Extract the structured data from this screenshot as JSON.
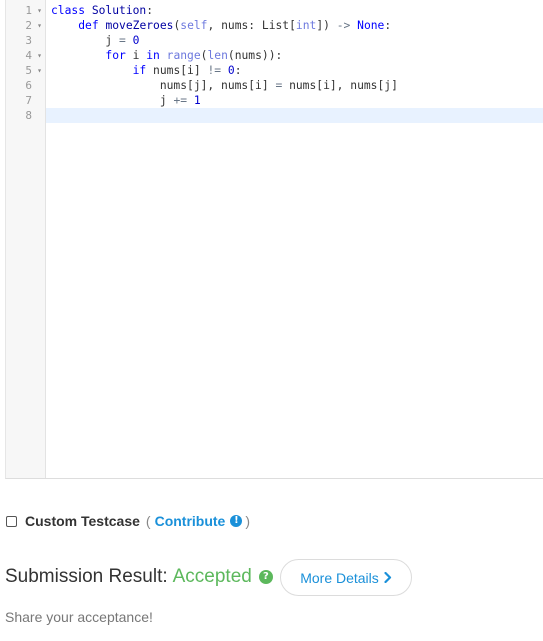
{
  "editor": {
    "line_numbers": [
      "1",
      "2",
      "3",
      "4",
      "5",
      "6",
      "7",
      "8"
    ],
    "fold_markers": [
      "▾",
      "▾",
      "",
      "▾",
      "▾",
      "",
      "",
      ""
    ],
    "active_line": 8,
    "lines": [
      [
        {
          "t": "class",
          "c": "kw"
        },
        {
          "t": " ",
          "c": "plain"
        },
        {
          "t": "Solution",
          "c": "cls"
        },
        {
          "t": ":",
          "c": "plain"
        }
      ],
      [
        {
          "t": "    ",
          "c": "plain"
        },
        {
          "t": "def",
          "c": "kw"
        },
        {
          "t": " ",
          "c": "plain"
        },
        {
          "t": "moveZeroes",
          "c": "fn"
        },
        {
          "t": "(",
          "c": "plain"
        },
        {
          "t": "self",
          "c": "builtin"
        },
        {
          "t": ", nums: List[",
          "c": "plain"
        },
        {
          "t": "int",
          "c": "builtin"
        },
        {
          "t": "]) ",
          "c": "plain"
        },
        {
          "t": "->",
          "c": "op"
        },
        {
          "t": " ",
          "c": "plain"
        },
        {
          "t": "None",
          "c": "const"
        },
        {
          "t": ":",
          "c": "plain"
        }
      ],
      [
        {
          "t": "        j ",
          "c": "plain"
        },
        {
          "t": "=",
          "c": "op"
        },
        {
          "t": " ",
          "c": "plain"
        },
        {
          "t": "0",
          "c": "num"
        }
      ],
      [
        {
          "t": "        ",
          "c": "plain"
        },
        {
          "t": "for",
          "c": "kw"
        },
        {
          "t": " i ",
          "c": "plain"
        },
        {
          "t": "in",
          "c": "kw"
        },
        {
          "t": " ",
          "c": "plain"
        },
        {
          "t": "range",
          "c": "builtin"
        },
        {
          "t": "(",
          "c": "plain"
        },
        {
          "t": "len",
          "c": "builtin"
        },
        {
          "t": "(nums)):",
          "c": "plain"
        }
      ],
      [
        {
          "t": "            ",
          "c": "plain"
        },
        {
          "t": "if",
          "c": "kw"
        },
        {
          "t": " nums[i] ",
          "c": "plain"
        },
        {
          "t": "!=",
          "c": "op"
        },
        {
          "t": " ",
          "c": "plain"
        },
        {
          "t": "0",
          "c": "num"
        },
        {
          "t": ":",
          "c": "plain"
        }
      ],
      [
        {
          "t": "                nums[j], nums[i] ",
          "c": "plain"
        },
        {
          "t": "=",
          "c": "op"
        },
        {
          "t": " nums[i], nums[j]",
          "c": "plain"
        }
      ],
      [
        {
          "t": "                j ",
          "c": "plain"
        },
        {
          "t": "+=",
          "c": "op"
        },
        {
          "t": " ",
          "c": "plain"
        },
        {
          "t": "1",
          "c": "num"
        }
      ],
      []
    ]
  },
  "testcase": {
    "label": "Custom Testcase",
    "open_paren": "(",
    "contribute_label": "Contribute",
    "close_paren": ")",
    "info_icon": "info-circle-icon"
  },
  "submission": {
    "label": "Submission Result:",
    "status": "Accepted",
    "status_color": "#5cb85c",
    "help_icon": "question-circle-icon"
  },
  "more_details": {
    "label": "More Details",
    "icon": "chevron-right-icon"
  },
  "share_text": "Share your acceptance!"
}
